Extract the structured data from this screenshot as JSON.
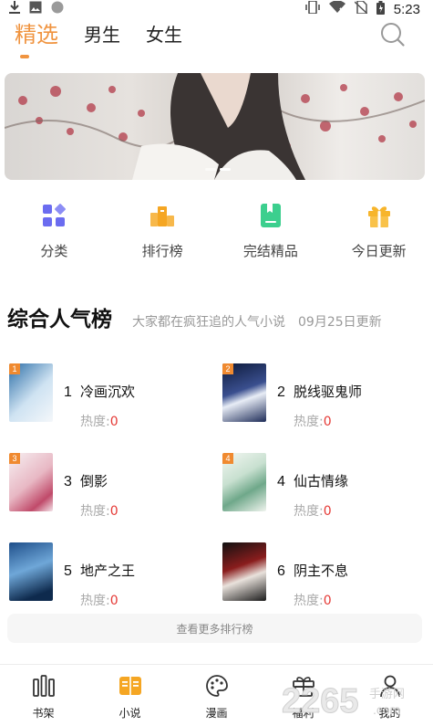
{
  "status_bar": {
    "time": "5:23",
    "icons": [
      "download-icon",
      "image-icon",
      "circle-icon",
      "vibrate-icon",
      "wifi-off-icon",
      "no-sim-icon",
      "battery-icon"
    ]
  },
  "top_tabs": [
    {
      "label": "精选",
      "active": true
    },
    {
      "label": "男生",
      "active": false
    },
    {
      "label": "女生",
      "active": false
    }
  ],
  "banner": {
    "slides": 2,
    "active_slide": 2
  },
  "quick_entries": [
    {
      "label": "分类",
      "icon": "grid-icon",
      "color": "#6b6cf0"
    },
    {
      "label": "排行榜",
      "icon": "podium-icon",
      "color": "#f5a623"
    },
    {
      "label": "完结精品",
      "icon": "book-mark-icon",
      "color": "#3ccf8e"
    },
    {
      "label": "今日更新",
      "icon": "gift-icon",
      "color": "#f7b52c"
    }
  ],
  "ranking": {
    "title": "综合人气榜",
    "subtitle": "大家都在疯狂追的人气小说",
    "date": "09月25日更新",
    "heat_label": "热度:",
    "items": [
      {
        "rank": "1",
        "title": "冷画沉欢",
        "heat": "0",
        "badge": "1"
      },
      {
        "rank": "2",
        "title": "脱线驱鬼师",
        "heat": "0",
        "badge": "2"
      },
      {
        "rank": "3",
        "title": "倒影",
        "heat": "0",
        "badge": "3"
      },
      {
        "rank": "4",
        "title": "仙古情缘",
        "heat": "0",
        "badge": "4"
      },
      {
        "rank": "5",
        "title": "地产之王",
        "heat": "0",
        "badge": ""
      },
      {
        "rank": "6",
        "title": "阴主不息",
        "heat": "0",
        "badge": ""
      }
    ],
    "more_label": "查看更多排行榜"
  },
  "bottom_nav": [
    {
      "label": "书架",
      "icon": "bookshelf-icon",
      "active": false
    },
    {
      "label": "小说",
      "icon": "book-icon",
      "active": true
    },
    {
      "label": "漫画",
      "icon": "palette-icon",
      "active": false
    },
    {
      "label": "福利",
      "icon": "gift-icon",
      "active": false
    },
    {
      "label": "我的",
      "icon": "person-icon",
      "active": false
    }
  ],
  "watermark": {
    "text": "2265",
    "suffix": "手游网",
    "domain": ".com"
  },
  "colors": {
    "accent": "#f09440",
    "heat": "#e53935",
    "badge": "#f08a30"
  }
}
